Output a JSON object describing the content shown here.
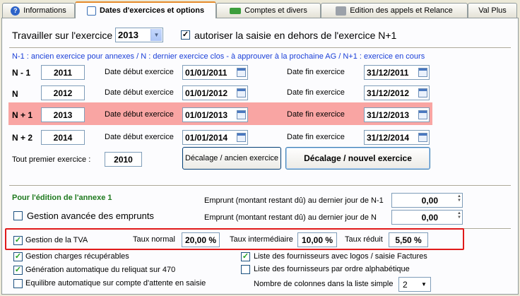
{
  "tabs": [
    {
      "label": "Informations"
    },
    {
      "label": "Dates d'exercices et options"
    },
    {
      "label": "Comptes et divers"
    },
    {
      "label": "Edition des appels et Relance"
    },
    {
      "label": "Val Plus"
    }
  ],
  "work_year": {
    "label": "Travailler sur l'exercice",
    "value": "2013",
    "allow_label": "autoriser la saisie en dehors de l'exercice N+1",
    "allow_checked": true
  },
  "legend": "N-1 : ancien exercice pour annexes  /  N : dernier exercice clos - à approuver à la prochaine AG  /  N+1 : exercice en cours",
  "exercises": {
    "start_label": "Date début exercice",
    "end_label": "Date fin exercice",
    "rows": [
      {
        "name": "N - 1",
        "year": "2011",
        "start": "01/01/2011",
        "end": "31/12/2011"
      },
      {
        "name": "N",
        "year": "2012",
        "start": "01/01/2012",
        "end": "31/12/2012"
      },
      {
        "name": "N + 1",
        "year": "2013",
        "start": "01/01/2013",
        "end": "31/12/2013"
      },
      {
        "name": "N + 2",
        "year": "2014",
        "start": "01/01/2014",
        "end": "31/12/2014"
      }
    ],
    "first_label": "Tout premier exercice :",
    "first_value": "2010",
    "btn_old": "Décalage / ancien exercice",
    "btn_new": "Décalage / nouvel exercice"
  },
  "annexe": {
    "title": "Pour l'édition de l'annexe 1",
    "loans_label": "Gestion avancée des emprunts",
    "loans_checked": false,
    "loan_n1_label": "Emprunt (montant restant dû) au dernier jour de N-1",
    "loan_n1_value": "0,00",
    "loan_n_label": "Emprunt (montant restant dû) au dernier jour de N",
    "loan_n_value": "0,00"
  },
  "tva": {
    "label": "Gestion de la TVA",
    "checked": true,
    "normal_label": "Taux normal",
    "normal_value": "20,00 %",
    "inter_label": "Taux intermédiaire",
    "inter_value": "10,00 %",
    "reduced_label": "Taux réduit",
    "reduced_value": "5,50 %"
  },
  "options": {
    "charges_label": "Gestion charges récupérables",
    "charges_checked": true,
    "reliquat_label": "Génération automatique du reliquat sur 470",
    "reliquat_checked": true,
    "equilibre_label": "Equilibre automatique sur compte d'attente en saisie",
    "equilibre_checked": false,
    "logos_label": "Liste des fournisseurs avec logos / saisie Factures",
    "logos_checked": true,
    "alpha_label": "Liste des fournisseurs par ordre alphabétique",
    "alpha_checked": false,
    "columns_label": "Nombre de colonnes dans la liste simple",
    "columns_value": "2"
  },
  "colors": {
    "highlight_row": "#f9a5a3",
    "tva_frame": "#e01a1a",
    "annexe_title": "#1f7a1f",
    "legend_text": "#1a3fd8"
  }
}
